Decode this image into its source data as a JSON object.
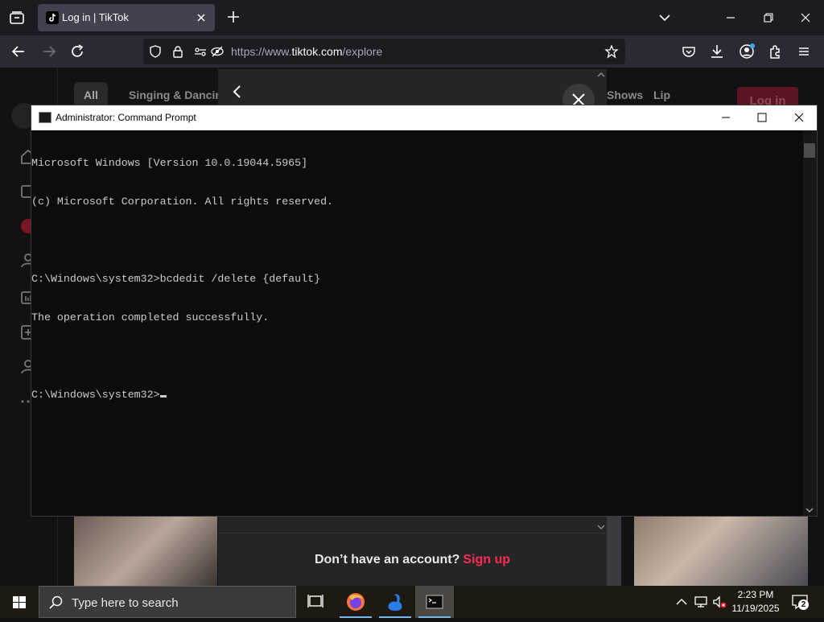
{
  "browser": {
    "tab_title": "Log in | TikTok",
    "url_prefix": "https://www.",
    "url_domain": "tiktok.com",
    "url_path": "/explore"
  },
  "tiktok": {
    "categories": [
      "All",
      "Singing & Dancing",
      "Shows",
      "Lip"
    ],
    "login_label": "Log in",
    "modal_footer_text": "Don’t have an account?",
    "modal_signup": "Sign up"
  },
  "cmd": {
    "title": "Administrator: Command Prompt",
    "lines": [
      "Microsoft Windows [Version 10.0.19044.5965]",
      "(c) Microsoft Corporation. All rights reserved.",
      "",
      "C:\\Windows\\system32>bcdedit /delete {default}",
      "The operation completed successfully.",
      "",
      "C:\\Windows\\system32>"
    ]
  },
  "taskbar": {
    "search_placeholder": "Type here to search",
    "time": "2:23 PM",
    "date": "11/19/2025",
    "notification_count": "2"
  },
  "colors": {
    "tiktok_accent": "#fe2c55",
    "console_text": "#cccccc",
    "console_bg": "#0c0c0c"
  }
}
